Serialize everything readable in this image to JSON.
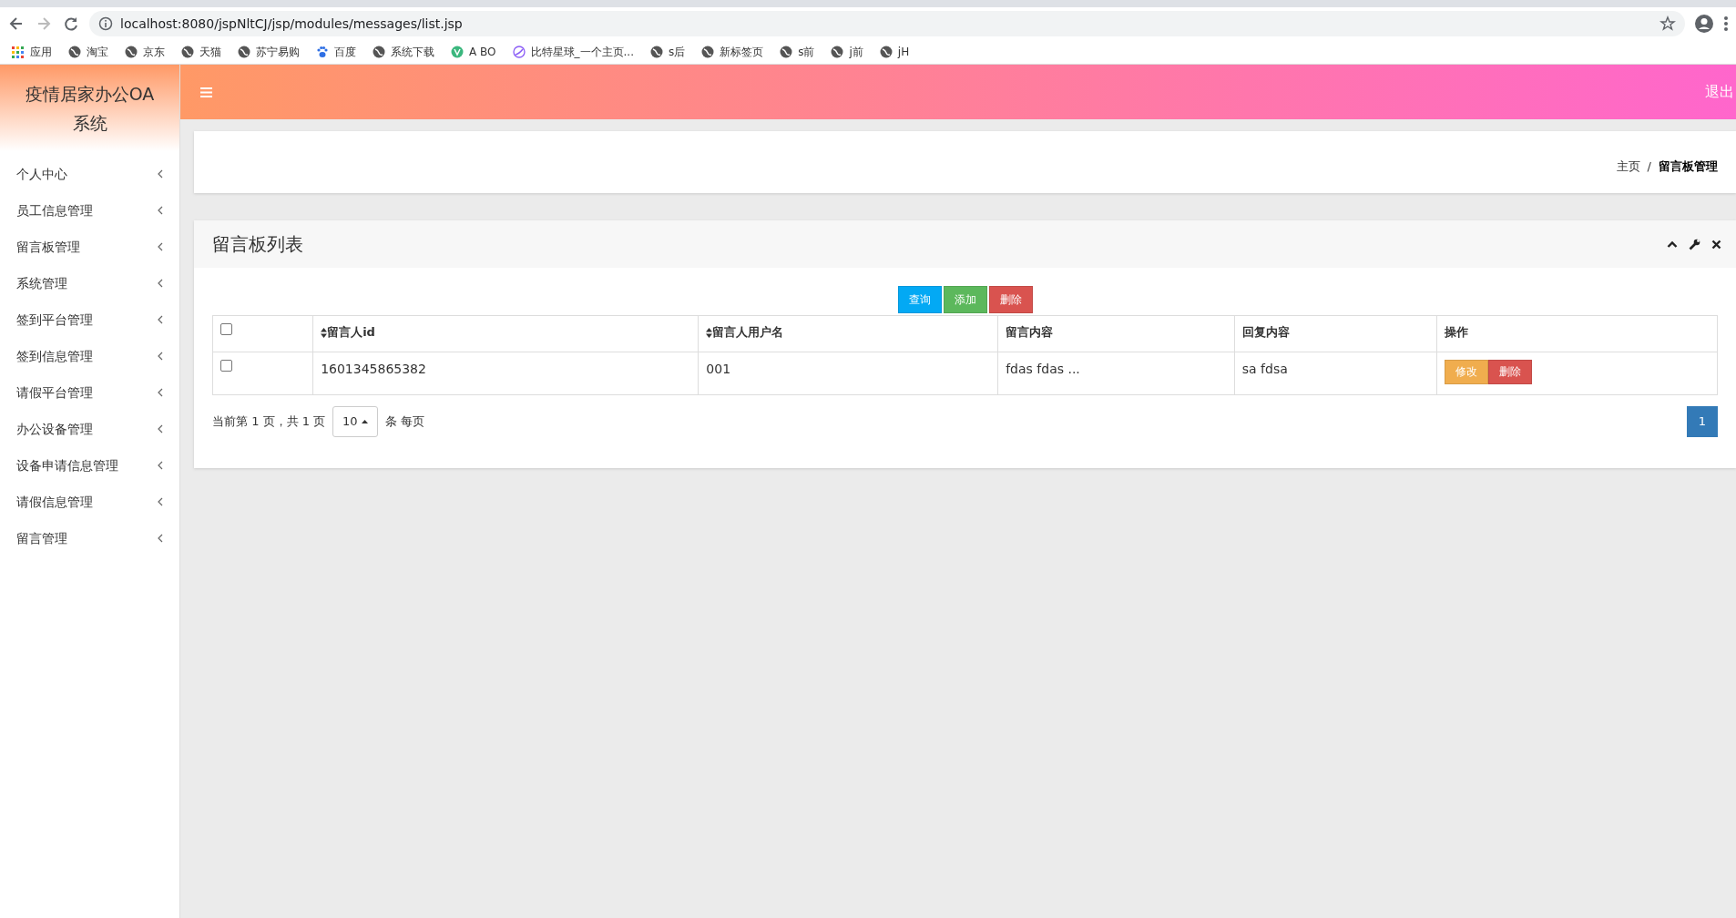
{
  "browser": {
    "url": "localhost:8080/jspNltCJ/jsp/modules/messages/list.jsp",
    "bookmarks": [
      {
        "label": "应用",
        "kind": "apps"
      },
      {
        "label": "淘宝",
        "kind": "globe"
      },
      {
        "label": "京东",
        "kind": "globe"
      },
      {
        "label": "天猫",
        "kind": "globe"
      },
      {
        "label": "苏宁易购",
        "kind": "globe"
      },
      {
        "label": "百度",
        "kind": "paw"
      },
      {
        "label": "系统下载",
        "kind": "globe"
      },
      {
        "label": "A BO",
        "kind": "leaf"
      },
      {
        "label": "比特星球_一个主页...",
        "kind": "swirl"
      },
      {
        "label": "s后",
        "kind": "globe"
      },
      {
        "label": "新标签页",
        "kind": "globe"
      },
      {
        "label": "s前",
        "kind": "globe"
      },
      {
        "label": "j前",
        "kind": "globe"
      },
      {
        "label": "jH",
        "kind": "globe"
      }
    ]
  },
  "app": {
    "title": "疫情居家办公OA系统",
    "logout": "退出"
  },
  "sidebar": {
    "items": [
      {
        "label": "个人中心"
      },
      {
        "label": "员工信息管理"
      },
      {
        "label": "留言板管理"
      },
      {
        "label": "系统管理"
      },
      {
        "label": "签到平台管理"
      },
      {
        "label": "签到信息管理"
      },
      {
        "label": "请假平台管理"
      },
      {
        "label": "办公设备管理"
      },
      {
        "label": "设备申请信息管理"
      },
      {
        "label": "请假信息管理"
      },
      {
        "label": "留言管理"
      }
    ]
  },
  "breadcrumb": {
    "separator": "/",
    "items": [
      {
        "label": "主页",
        "active": false
      },
      {
        "label": "留言板管理",
        "active": true
      }
    ]
  },
  "panel": {
    "title": "留言板列表",
    "toolbar": [
      {
        "label": "查询",
        "kind": "info"
      },
      {
        "label": "添加",
        "kind": "success"
      },
      {
        "label": "删除",
        "kind": "danger"
      }
    ],
    "table": {
      "select_all_checked": false,
      "columns": [
        {
          "label": "留言人id",
          "sortable": true
        },
        {
          "label": "留言人用户名",
          "sortable": true
        },
        {
          "label": "留言内容",
          "sortable": false
        },
        {
          "label": "回复内容",
          "sortable": false
        },
        {
          "label": "操作",
          "sortable": false
        }
      ],
      "rows": [
        {
          "checked": false,
          "cells": [
            "1601345865382",
            "001",
            "fdas fdas ...",
            "sa fdsa"
          ],
          "actions": [
            {
              "label": "修改",
              "kind": "warning"
            },
            {
              "label": "删除",
              "kind": "danger"
            }
          ]
        }
      ]
    },
    "pagination": {
      "info": "当前第 1 页，共 1 页",
      "page_size": "10",
      "suffix": "条 每页",
      "pages": [
        {
          "label": "1",
          "selected": true
        }
      ]
    }
  }
}
